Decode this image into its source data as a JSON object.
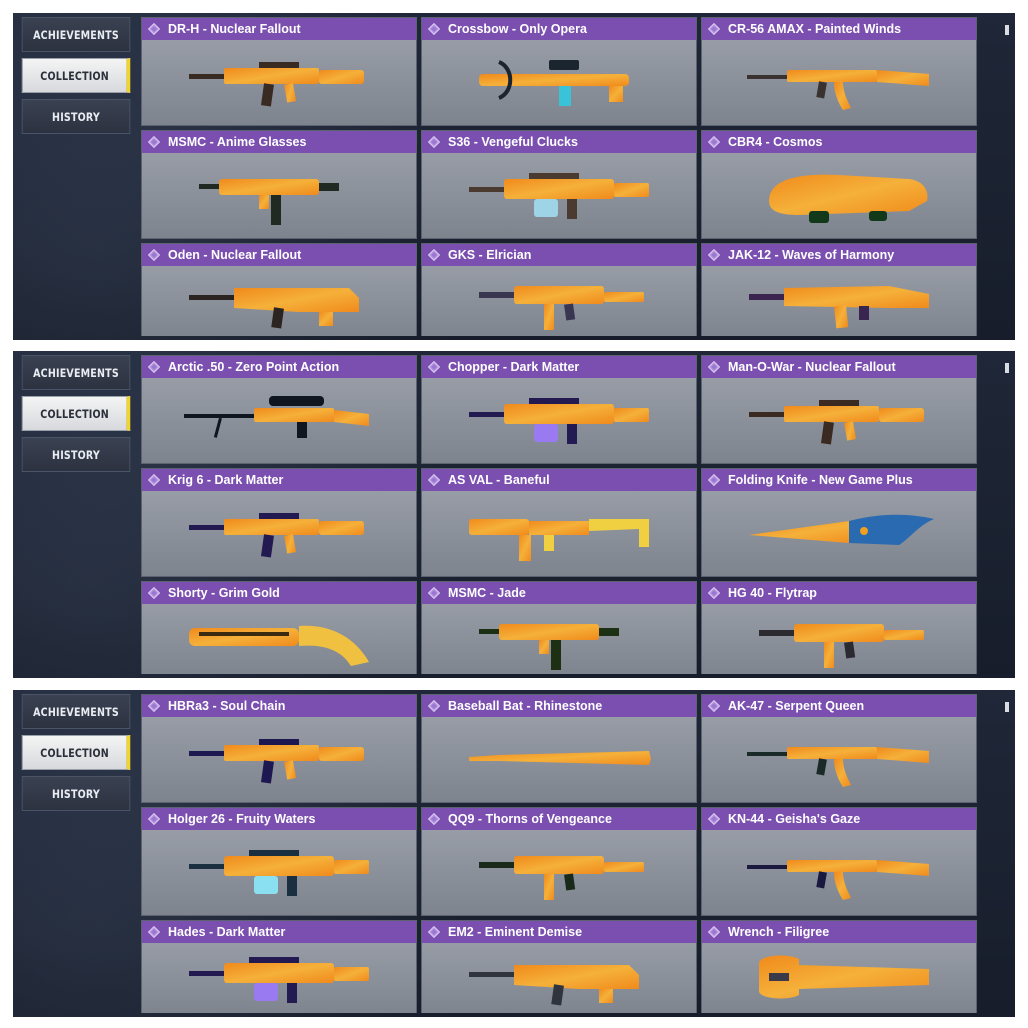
{
  "nav": {
    "achievements": "ACHIEVEMENTS",
    "collection": "COLLECTION",
    "history": "HISTORY"
  },
  "colors": {
    "header_purple": "#7a4fb0",
    "active_accent": "#f1d52b",
    "panel_bg": "#1d2536",
    "card_bg": "#8d929b"
  },
  "panels": [
    {
      "items": [
        {
          "name": "DR-H - Nuclear Fallout",
          "kind": "rifle",
          "colors": [
            "#f08a1c",
            "#f5b13a",
            "#3a2b22"
          ]
        },
        {
          "name": "Crossbow - Only Opera",
          "kind": "crossbow",
          "colors": [
            "#2e8fb8",
            "#3ac2d9",
            "#1a2530"
          ]
        },
        {
          "name": "CR-56 AMAX - Painted Winds",
          "kind": "ak",
          "colors": [
            "#d9d2cc",
            "#c0603a",
            "#3a3230"
          ]
        },
        {
          "name": "MSMC - Anime Glasses",
          "kind": "smg",
          "colors": [
            "#2f5a3a",
            "#5ccf6b",
            "#202a22"
          ]
        },
        {
          "name": "S36 - Vengeful Clucks",
          "kind": "lmg",
          "colors": [
            "#c8b39a",
            "#9fd4e6",
            "#4a3a30"
          ]
        },
        {
          "name": "CBR4 - Cosmos",
          "kind": "p90",
          "colors": [
            "#1fb33a",
            "#7ee04a",
            "#123a1a"
          ]
        },
        {
          "name": "Oden - Nuclear Fallout",
          "kind": "bullpup",
          "colors": [
            "#f07a18",
            "#f59a3a",
            "#2b2420"
          ]
        },
        {
          "name": "GKS - Elrician",
          "kind": "smg2",
          "colors": [
            "#a08ad0",
            "#7fc6e6",
            "#3a3550"
          ]
        },
        {
          "name": "JAK-12 - Waves of Harmony",
          "kind": "shotgun",
          "colors": [
            "#8b5cc6",
            "#d0a0e8",
            "#3a2450"
          ]
        }
      ]
    },
    {
      "items": [
        {
          "name": "Arctic .50 - Zero Point Action",
          "kind": "sniper",
          "colors": [
            "#1c2e4a",
            "#3a7fd0",
            "#101620"
          ]
        },
        {
          "name": "Chopper - Dark Matter",
          "kind": "lmg2",
          "colors": [
            "#5a3ad0",
            "#9a7af0",
            "#221a50"
          ]
        },
        {
          "name": "Man-O-War - Nuclear Fallout",
          "kind": "rifle",
          "colors": [
            "#e8701c",
            "#f5a23a",
            "#3a2a22"
          ]
        },
        {
          "name": "Krig 6 - Dark Matter",
          "kind": "rifle2",
          "colors": [
            "#6a48e0",
            "#b08af5",
            "#221a50"
          ]
        },
        {
          "name": "AS VAL - Baneful",
          "kind": "asval",
          "colors": [
            "#3a2a30",
            "#e05aa0",
            "#f0d040"
          ]
        },
        {
          "name": "Folding Knife - New Game Plus",
          "kind": "knife",
          "colors": [
            "#2a6ab0",
            "#f0a020",
            "#1a2030"
          ]
        },
        {
          "name": "Shorty - Grim Gold",
          "kind": "shorty",
          "colors": [
            "#c8962a",
            "#f0c040",
            "#3a2a10"
          ]
        },
        {
          "name": "MSMC - Jade",
          "kind": "smg",
          "colors": [
            "#3f7a2a",
            "#6ab040",
            "#1e3014"
          ]
        },
        {
          "name": "HG 40 - Flytrap",
          "kind": "smg3",
          "colors": [
            "#5a4a6a",
            "#e050a0",
            "#2a2a30"
          ]
        }
      ]
    },
    {
      "items": [
        {
          "name": "HBRa3 - Soul Chain",
          "kind": "rifle2",
          "colors": [
            "#4a3ab0",
            "#8a6ae0",
            "#1e1850"
          ]
        },
        {
          "name": "Baseball Bat - Rhinestone",
          "kind": "bat",
          "colors": [
            "#2a8ad0",
            "#60e0d0",
            "#3a3a5a"
          ]
        },
        {
          "name": "AK-47 - Serpent Queen",
          "kind": "ak",
          "colors": [
            "#3a6a5a",
            "#6ab0a0",
            "#1a2a26"
          ]
        },
        {
          "name": "Holger 26 - Fruity Waters",
          "kind": "lmg3",
          "colors": [
            "#2ab0e0",
            "#8ae0f0",
            "#1a3040"
          ]
        },
        {
          "name": "QQ9 - Thorns of Vengeance",
          "kind": "smg2",
          "colors": [
            "#3a7a3a",
            "#6ac060",
            "#1a2a1a"
          ]
        },
        {
          "name": "KN-44 - Geisha's Gaze",
          "kind": "ak",
          "colors": [
            "#3a4ab0",
            "#e060a0",
            "#1a1a40"
          ]
        },
        {
          "name": "Hades - Dark Matter",
          "kind": "lmg2",
          "colors": [
            "#5a3ad0",
            "#9a7af0",
            "#221a50"
          ]
        },
        {
          "name": "EM2 - Eminent Demise",
          "kind": "bullpup2",
          "colors": [
            "#e0e4ea",
            "#6a90c0",
            "#30343c"
          ]
        },
        {
          "name": "Wrench - Filigree",
          "kind": "wrench",
          "colors": [
            "#f0f0f2",
            "#9aa4c0",
            "#3a3a4a"
          ]
        }
      ]
    }
  ]
}
